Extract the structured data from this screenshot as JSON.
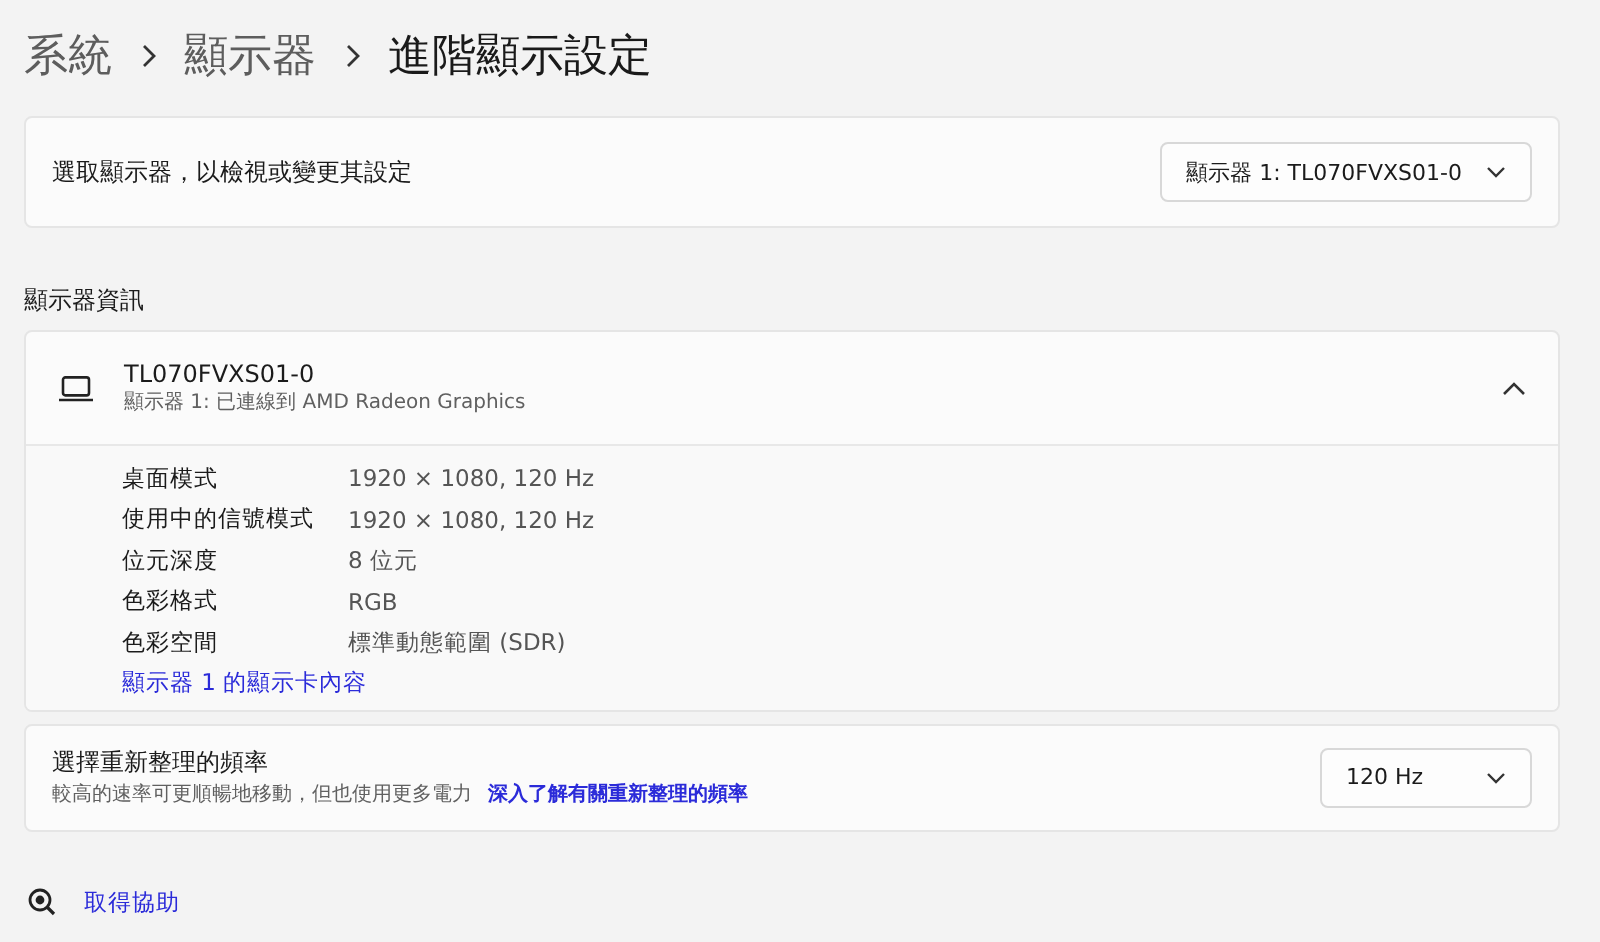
{
  "breadcrumb": [
    {
      "label": "系統",
      "current": false
    },
    {
      "label": "顯示器",
      "current": false
    },
    {
      "label": "進階顯示設定",
      "current": true
    }
  ],
  "select_display": {
    "label": "選取顯示器，以檢視或變更其設定",
    "value": "顯示器 1: TL070FVXS01-0"
  },
  "display_info": {
    "heading": "顯示器資訊",
    "name": "TL070FVXS01-0",
    "subtitle": "顯示器 1: 已連線到 AMD Radeon Graphics",
    "expanded": true,
    "rows": [
      {
        "label": "桌面模式",
        "value": "1920 × 1080, 120 Hz"
      },
      {
        "label": "使用中的信號模式",
        "value": "1920 × 1080, 120 Hz"
      },
      {
        "label": "位元深度",
        "value": "8 位元"
      },
      {
        "label": "色彩格式",
        "value": "RGB"
      },
      {
        "label": "色彩空間",
        "value": "標準動態範圍 (SDR)"
      }
    ],
    "link": "顯示器 1 的顯示卡內容"
  },
  "refresh_rate": {
    "label": "選擇重新整理的頻率",
    "description": "較高的速率可更順暢地移動，但也使用更多電力",
    "link": "深入了解有關重新整理的頻率",
    "value": "120 Hz"
  },
  "help": {
    "label": "取得協助"
  }
}
